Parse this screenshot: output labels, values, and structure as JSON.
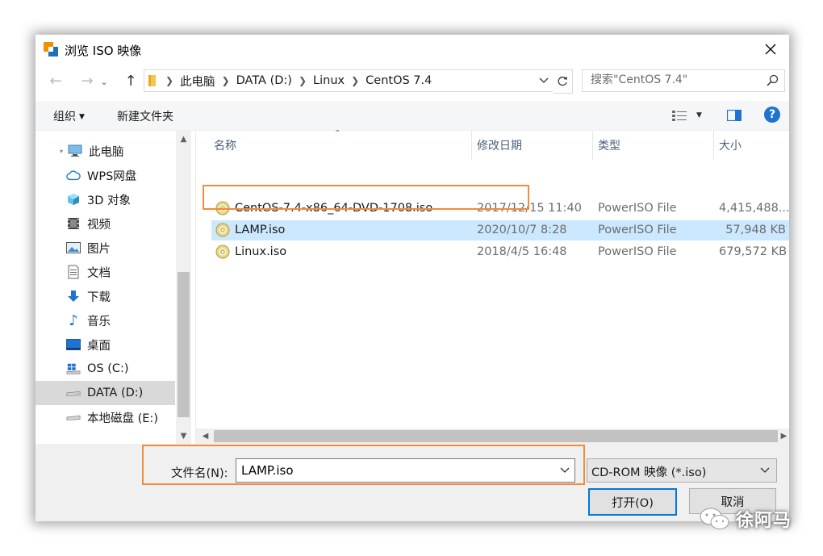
{
  "window": {
    "title": "浏览 ISO 映像"
  },
  "address": {
    "crumbs": [
      "此电脑",
      "DATA (D:)",
      "Linux",
      "CentOS 7.4"
    ]
  },
  "search": {
    "placeholder": "搜索\"CentOS 7.4\""
  },
  "toolbar": {
    "organize_label": "组织",
    "new_folder_label": "新建文件夹",
    "help_label": "?"
  },
  "navpane": {
    "items": [
      {
        "label": "此电脑",
        "icon": "computer-icon"
      },
      {
        "label": "WPS网盘",
        "icon": "cloud-icon"
      },
      {
        "label": "3D 对象",
        "icon": "cube-icon"
      },
      {
        "label": "视频",
        "icon": "video-icon"
      },
      {
        "label": "图片",
        "icon": "picture-icon"
      },
      {
        "label": "文档",
        "icon": "document-icon"
      },
      {
        "label": "下载",
        "icon": "download-icon"
      },
      {
        "label": "音乐",
        "icon": "music-icon"
      },
      {
        "label": "桌面",
        "icon": "desktop-icon"
      },
      {
        "label": "OS (C:)",
        "icon": "windows-drive-icon"
      },
      {
        "label": "DATA (D:)",
        "icon": "drive-icon"
      },
      {
        "label": "本地磁盘 (E:)",
        "icon": "drive-icon"
      }
    ],
    "selected_index": 10
  },
  "filelist": {
    "columns": [
      "名称",
      "修改日期",
      "类型",
      "大小"
    ],
    "rows": [
      {
        "name": "CentOS-7.4-x86_64-DVD-1708.iso",
        "date": "2017/12/15 11:40",
        "type": "PowerISO File",
        "size": "4,415,488..."
      },
      {
        "name": "LAMP.iso",
        "date": "2020/10/7 8:28",
        "type": "PowerISO File",
        "size": "57,948 KB"
      },
      {
        "name": "Linux.iso",
        "date": "2018/4/5 16:48",
        "type": "PowerISO File",
        "size": "679,572 KB"
      }
    ],
    "selected_index": 1
  },
  "footer": {
    "filename_label": "文件名(N):",
    "filename_value": "LAMP.iso",
    "filetype_value": "CD-ROM 映像 (*.iso)",
    "open_label": "打开(O)",
    "cancel_label": "取消"
  },
  "watermark": {
    "text": "徐阿马"
  },
  "colors": {
    "accent": "#0078d7",
    "selection": "#cce8ff",
    "callout": "#f08c3c",
    "header_text": "#4c607a"
  }
}
